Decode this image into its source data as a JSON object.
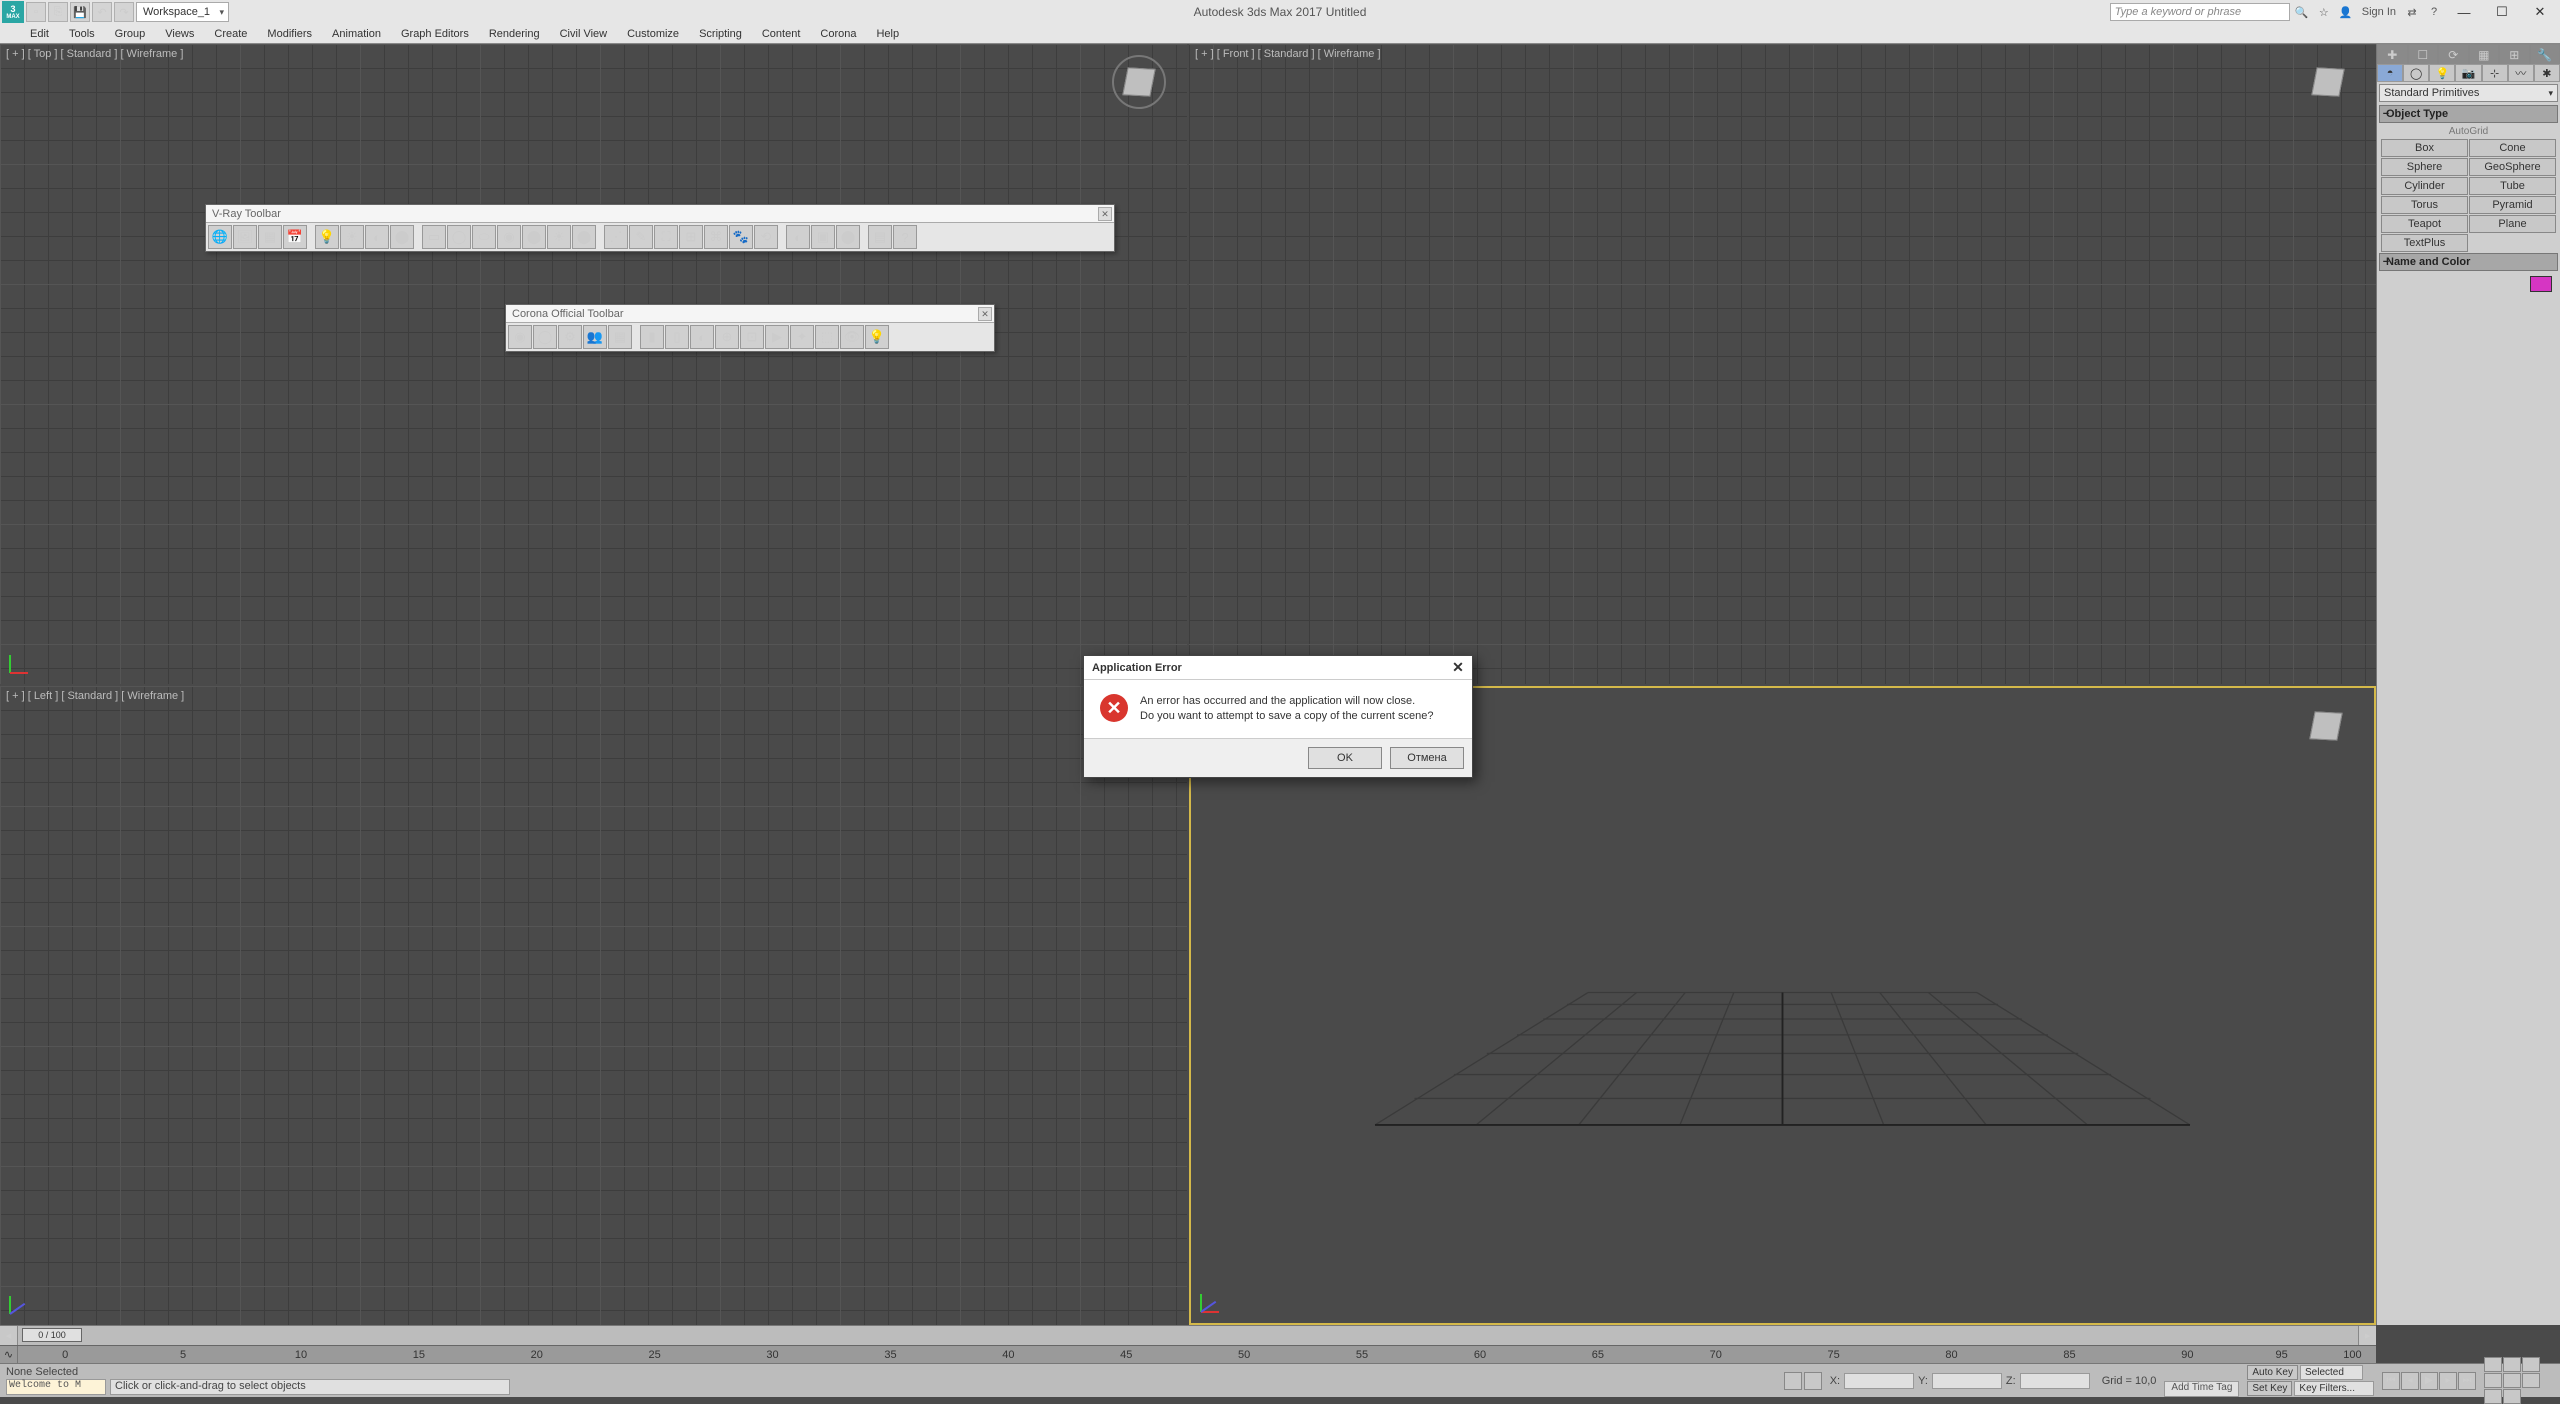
{
  "title": "Autodesk 3ds Max 2017   Untitled",
  "workspace": "Workspace_1",
  "search_placeholder": "Type a keyword or phrase",
  "signin": "Sign In",
  "menu": [
    "Edit",
    "Tools",
    "Group",
    "Views",
    "Create",
    "Modifiers",
    "Animation",
    "Graph Editors",
    "Rendering",
    "Civil View",
    "Customize",
    "Scripting",
    "Content",
    "Corona",
    "Help"
  ],
  "viewports": {
    "top": "[ + ] [ Top ] [ Standard ] [ Wireframe ]",
    "front": "[ + ] [ Front ] [ Standard ] [ Wireframe ]",
    "left": "[ + ] [ Left ] [ Standard ] [ Wireframe ]",
    "persp": ""
  },
  "vray_toolbar_title": "V-Ray Toolbar",
  "corona_toolbar_title": "Corona Official Toolbar",
  "cmdpanel": {
    "dropdown": "Standard Primitives",
    "rollout_object_type": "Object Type",
    "autogrid": "AutoGrid",
    "buttons": [
      [
        "Box",
        "Cone"
      ],
      [
        "Sphere",
        "GeoSphere"
      ],
      [
        "Cylinder",
        "Tube"
      ],
      [
        "Torus",
        "Pyramid"
      ],
      [
        "Teapot",
        "Plane"
      ],
      [
        "TextPlus",
        ""
      ]
    ],
    "rollout_name_color": "Name and Color"
  },
  "timeline": {
    "handle": "0 / 100"
  },
  "trackbar_ticks": [
    "0",
    "5",
    "10",
    "15",
    "20",
    "25",
    "30",
    "35",
    "40",
    "45",
    "50",
    "55",
    "60",
    "65",
    "70",
    "75",
    "80",
    "85",
    "90",
    "95",
    "100"
  ],
  "status": {
    "script": "Welcome to M",
    "selection": "None Selected",
    "prompt": "Click or click-and-drag to select objects",
    "coords_labels": {
      "x": "X:",
      "y": "Y:",
      "z": "Z:"
    },
    "grid": "Grid = 10,0",
    "addtag": "Add Time Tag",
    "autokey": "Auto Key",
    "setkey": "Set Key",
    "selected": "Selected",
    "keyfilters": "Key Filters..."
  },
  "dialog": {
    "title": "Application Error",
    "line1": "An error has occurred and the application will now close.",
    "line2": "Do you want to attempt to save a copy of the current scene?",
    "ok": "OK",
    "cancel": "Отмена"
  }
}
